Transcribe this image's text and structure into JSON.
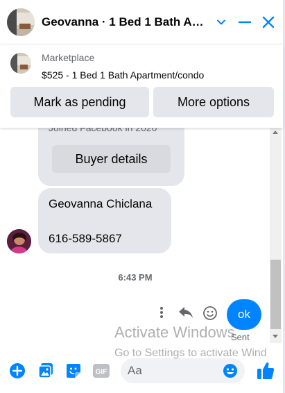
{
  "header": {
    "title": "Geovanna · 1 Bed 1 Bath A…",
    "minimize_icon": "chevron-down-icon",
    "collapse_icon": "minus-icon",
    "close_icon": "close-icon"
  },
  "marketplace": {
    "label": "Marketplace",
    "listing": "$525 - 1 Bed 1 Bath Apartment/condo",
    "mark_pending_label": "Mark as pending",
    "more_options_label": "More options"
  },
  "messages": {
    "joined_text": "Joined Facebook in 2020",
    "buyer_details_label": "Buyer details",
    "contact_name": "Geovanna Chiclana",
    "contact_phone": "616-589-5867",
    "timestamp": "6:43 PM",
    "outgoing_text": "ok",
    "outgoing_status": "Sent"
  },
  "watermark": {
    "line1": "Activate Windows",
    "line2": "Go to Settings to activate Wind"
  },
  "composer": {
    "placeholder": "Aa",
    "gif_label": "GIF"
  },
  "colors": {
    "accent": "#0084ff",
    "bubble_gray": "#e4e6eb",
    "text_secondary": "#65676b"
  }
}
